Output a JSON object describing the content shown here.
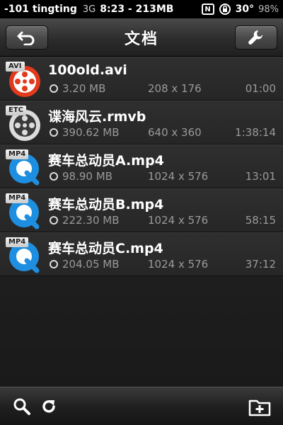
{
  "status_bar": {
    "carrier": "-101 tingting",
    "network": "3G",
    "time_memory": "8:23 - 213MB",
    "temperature": "30°",
    "battery": "98%"
  },
  "nav": {
    "title": "文档",
    "back_icon": "back-arrow-icon",
    "settings_icon": "wrench-icon"
  },
  "files": [
    {
      "name": "100old.avi",
      "badge": "AVI",
      "icon": "film-reel-icon",
      "size": "3.20 MB",
      "dimensions": "208 x 176",
      "duration": "01:00"
    },
    {
      "name": "谍海风云.rmvb",
      "badge": "ETC",
      "icon": "film-reel-icon",
      "size": "390.62 MB",
      "dimensions": "640 x 360",
      "duration": "1:38:14"
    },
    {
      "name": "赛车总动员A.mp4",
      "badge": "MP4",
      "icon": "quicktime-icon",
      "size": "98.90 MB",
      "dimensions": "1024 x 576",
      "duration": "13:01"
    },
    {
      "name": "赛车总动员B.mp4",
      "badge": "MP4",
      "icon": "quicktime-icon",
      "size": "222.30 MB",
      "dimensions": "1024 x 576",
      "duration": "58:15"
    },
    {
      "name": "赛车总动员C.mp4",
      "badge": "MP4",
      "icon": "quicktime-icon",
      "size": "204.05 MB",
      "dimensions": "1024 x 576",
      "duration": "37:12"
    }
  ],
  "toolbar": {
    "search_icon": "search-icon",
    "refresh_icon": "refresh-icon",
    "add_folder_icon": "add-folder-icon"
  },
  "colors": {
    "background": "#1a1a1a",
    "avi_icon": "#e23a1c",
    "quicktime_icon": "#1e8fe0",
    "meta_text": "#9a9a9a"
  }
}
